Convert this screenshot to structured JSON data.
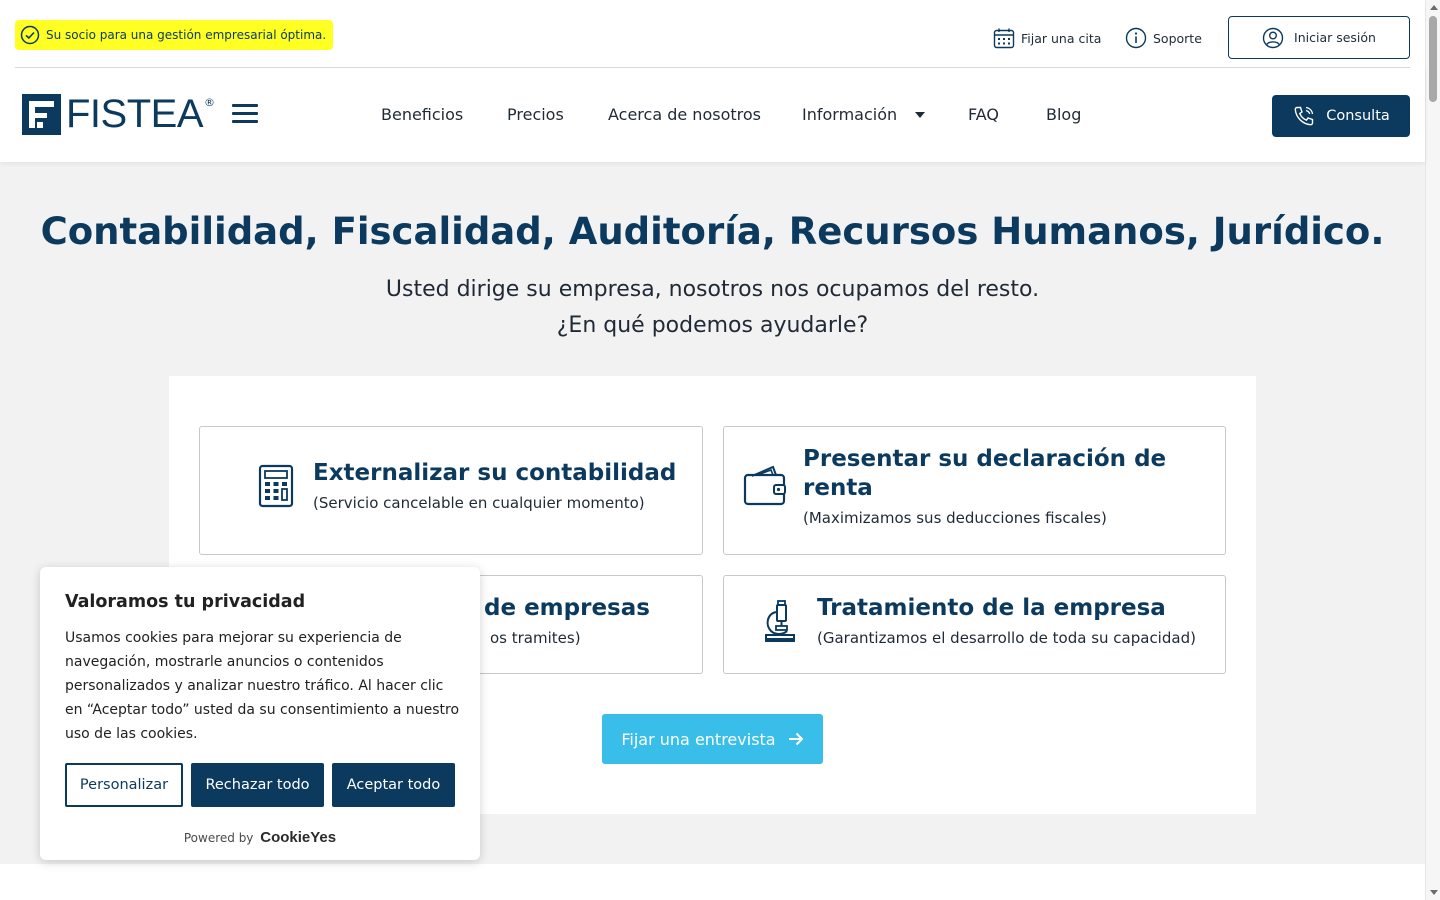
{
  "topbar": {
    "tagline": "Su socio para una gestión empresarial óptima.",
    "appointment_label": "Fijar una cita",
    "support_label": "Soporte",
    "login_label": "Iniciar sesión"
  },
  "nav": {
    "logo_text": "FISTEA",
    "logo_reg": "®",
    "items": [
      "Beneficios",
      "Precios",
      "Acerca de nosotros",
      "Información",
      "FAQ",
      "Blog"
    ],
    "consult_label": "Consulta"
  },
  "hero": {
    "title": "Contabilidad, Fiscalidad, Auditoría, Recursos Humanos, Jurídico.",
    "subtitle_1": "Usted dirige su empresa, nosotros nos ocupamos del resto.",
    "subtitle_2": "¿En qué podemos ayudarle?"
  },
  "cards": [
    {
      "title": "Externalizar su contabilidad",
      "desc": "(Servicio cancelable en cualquier momento)",
      "icon": "calculator-icon"
    },
    {
      "title": "Presentar su declaración de renta",
      "desc": "(Maximizamos sus deducciones fiscales)",
      "icon": "wallet-icon"
    },
    {
      "title": "de empresas",
      "desc": "os tramites)",
      "icon": ""
    },
    {
      "title": "Tratamiento de la empresa",
      "desc": "(Garantizamos el desarrollo de toda su capacidad)",
      "icon": "microscope-icon"
    }
  ],
  "cta_label": "Fijar una entrevista",
  "cookie": {
    "title": "Valoramos tu privacidad",
    "text": "Usamos cookies para mejorar su experiencia de navegación, mostrarle anuncios o contenidos personalizados y analizar nuestro tráfico. Al hacer clic en “Aceptar todo” usted da su consentimiento a nuestro uso de las cookies.",
    "customize_label": "Personalizar",
    "reject_label": "Rechazar todo",
    "accept_label": "Aceptar todo",
    "powered_by": "Powered by",
    "brand": "CookieYes"
  },
  "colors": {
    "brand_navy": "#0b3a5e",
    "cta_blue": "#39bde9",
    "highlight_yellow": "#ffff24",
    "hero_bg": "#f2f2f2"
  }
}
